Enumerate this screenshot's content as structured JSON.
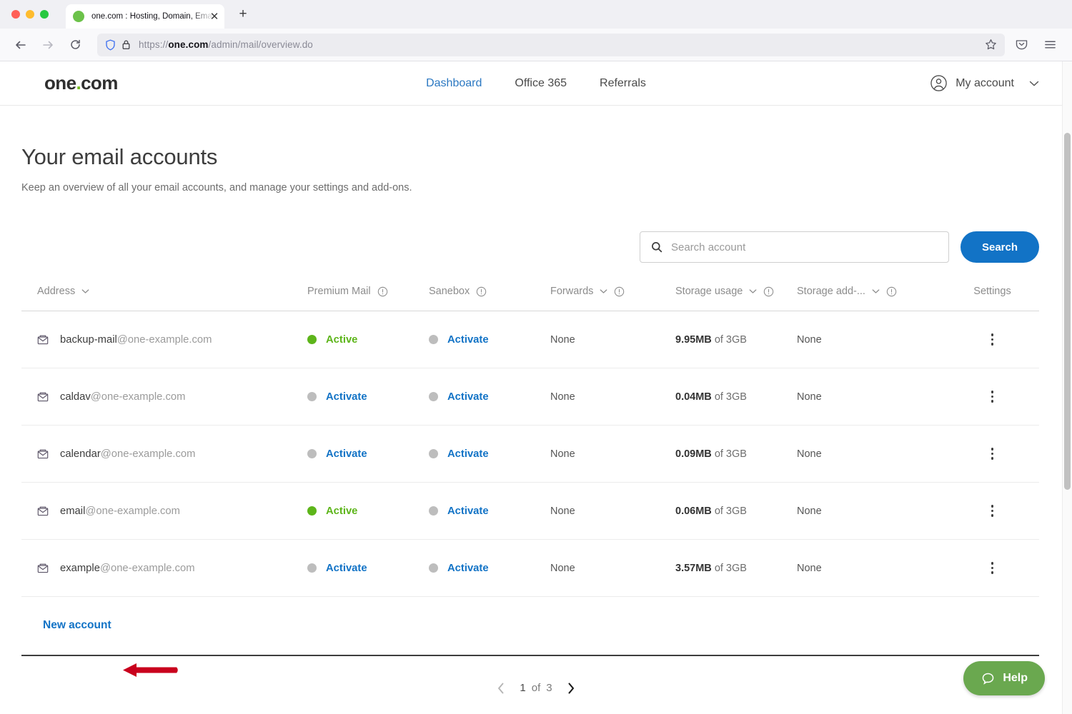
{
  "browser": {
    "tab": {
      "title": "one.com : Hosting, Domain, Ema",
      "favicon": "green-circle-favicon",
      "close": "✕"
    },
    "newtab_label": "+",
    "back_icon": "back-arrow-icon",
    "forward_icon": "forward-arrow-icon",
    "reload_icon": "reload-icon",
    "url": {
      "scheme": "https://",
      "host": "one.com",
      "path": "/admin/mail/overview.do",
      "full": "https://one.com/admin/mail/overview.do"
    },
    "shield_icon": "shield-icon",
    "lock_icon": "padlock-icon",
    "bookmark_icon": "star-icon",
    "pocket_icon": "pocket-icon",
    "menu_icon": "hamburger-menu-icon"
  },
  "header": {
    "logo": {
      "prefix": "one",
      "dot": ".",
      "suffix": "com"
    },
    "nav": [
      {
        "label": "Dashboard",
        "active": true
      },
      {
        "label": "Office 365",
        "active": false
      },
      {
        "label": "Referrals",
        "active": false
      }
    ],
    "account": {
      "label": "My account",
      "avatar_icon": "user-circle-icon",
      "caret_icon": "chevron-down-icon"
    }
  },
  "page": {
    "title": "Your email accounts",
    "subtitle": "Keep an overview of all your email accounts, and manage your settings and add-ons."
  },
  "search": {
    "placeholder": "Search account",
    "value": "",
    "icon": "search-icon",
    "button_label": "Search"
  },
  "table": {
    "columns": [
      {
        "label": "Address",
        "sortable": true,
        "info": false
      },
      {
        "label": "Premium Mail",
        "sortable": false,
        "info": true
      },
      {
        "label": "Sanebox",
        "sortable": false,
        "info": true
      },
      {
        "label": "Forwards",
        "sortable": true,
        "info": true
      },
      {
        "label": "Storage usage",
        "sortable": true,
        "info": true
      },
      {
        "label": "Storage add-...",
        "sortable": true,
        "info": true
      },
      {
        "label": "Settings",
        "sortable": false,
        "info": false
      }
    ],
    "rows": [
      {
        "local": "backup-mail",
        "domain": "@one-example.com",
        "premium": {
          "label": "Active",
          "state": "on"
        },
        "sanebox": {
          "label": "Activate",
          "state": "off"
        },
        "forwards": "None",
        "storage_used": "9.95MB",
        "storage_of": "of 3GB",
        "storage_addon": "None",
        "settings_icon": "kebab-menu-icon"
      },
      {
        "local": "caldav",
        "domain": "@one-example.com",
        "premium": {
          "label": "Activate",
          "state": "off"
        },
        "sanebox": {
          "label": "Activate",
          "state": "off"
        },
        "forwards": "None",
        "storage_used": "0.04MB",
        "storage_of": "of 3GB",
        "storage_addon": "None",
        "settings_icon": "kebab-menu-icon"
      },
      {
        "local": "calendar",
        "domain": "@one-example.com",
        "premium": {
          "label": "Activate",
          "state": "off"
        },
        "sanebox": {
          "label": "Activate",
          "state": "off"
        },
        "forwards": "None",
        "storage_used": "0.09MB",
        "storage_of": "of 3GB",
        "storage_addon": "None",
        "settings_icon": "kebab-menu-icon"
      },
      {
        "local": "email",
        "domain": "@one-example.com",
        "premium": {
          "label": "Active",
          "state": "on"
        },
        "sanebox": {
          "label": "Activate",
          "state": "off"
        },
        "forwards": "None",
        "storage_used": "0.06MB",
        "storage_of": "of 3GB",
        "storage_addon": "None",
        "settings_icon": "kebab-menu-icon"
      },
      {
        "local": "example",
        "domain": "@one-example.com",
        "premium": {
          "label": "Activate",
          "state": "off"
        },
        "sanebox": {
          "label": "Activate",
          "state": "off"
        },
        "forwards": "None",
        "storage_used": "3.57MB",
        "storage_of": "of 3GB",
        "storage_addon": "None",
        "settings_icon": "kebab-menu-icon"
      }
    ],
    "new_account_label": "New account"
  },
  "pagination": {
    "prev_icon": "chevron-left-icon",
    "next_icon": "chevron-right-icon",
    "current": "1",
    "of_label": "of",
    "total": "3"
  },
  "help": {
    "label": "Help",
    "icon": "chat-bubble-icon"
  },
  "annotation": {
    "type": "red-arrow-left",
    "color": "#c9001d",
    "points_to": "New account"
  },
  "colors": {
    "brand_blue": "#1273c6",
    "active_green": "#5db51a",
    "logo_dot_green": "#76bc21",
    "help_green": "#6aa84f",
    "annotation_red": "#c9001d"
  }
}
